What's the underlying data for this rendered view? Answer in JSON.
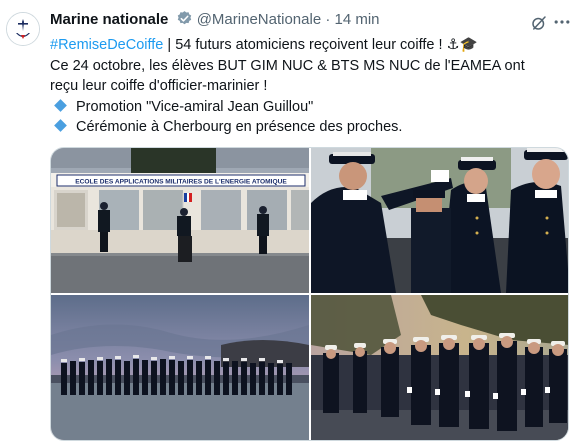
{
  "author": {
    "name": "Marine nationale",
    "handle": "@MarineNationale",
    "time": "14 min",
    "separator": "·",
    "verified_color": "#829aab"
  },
  "tweet": {
    "line1_hashtag": "#RemiseDeCoiffe",
    "line1_text": " | 54 futurs atomiciens reçoivent leur coiffe ! ",
    "line1_emoji": "⚓🎓",
    "line2": "Ce 24 octobre, les élèves BUT GIM NUC & BTS MS NUC de l'EAMEA ont",
    "line3": "reçu leur coiffe d'officier-marinier !",
    "bullet1": "Promotion \"Vice-amiral Jean Guillou\"",
    "bullet2": "Cérémonie à Cherbourg en présence des proches."
  },
  "media": {
    "photo1_banner": "ECOLE DES APPLICATIONS MILITAIRES DE L'ENERGIE ATOMIQUE"
  },
  "colors": {
    "link": "#1d9bf0",
    "secondary": "#536471",
    "bullet": "#4a9fe0"
  }
}
